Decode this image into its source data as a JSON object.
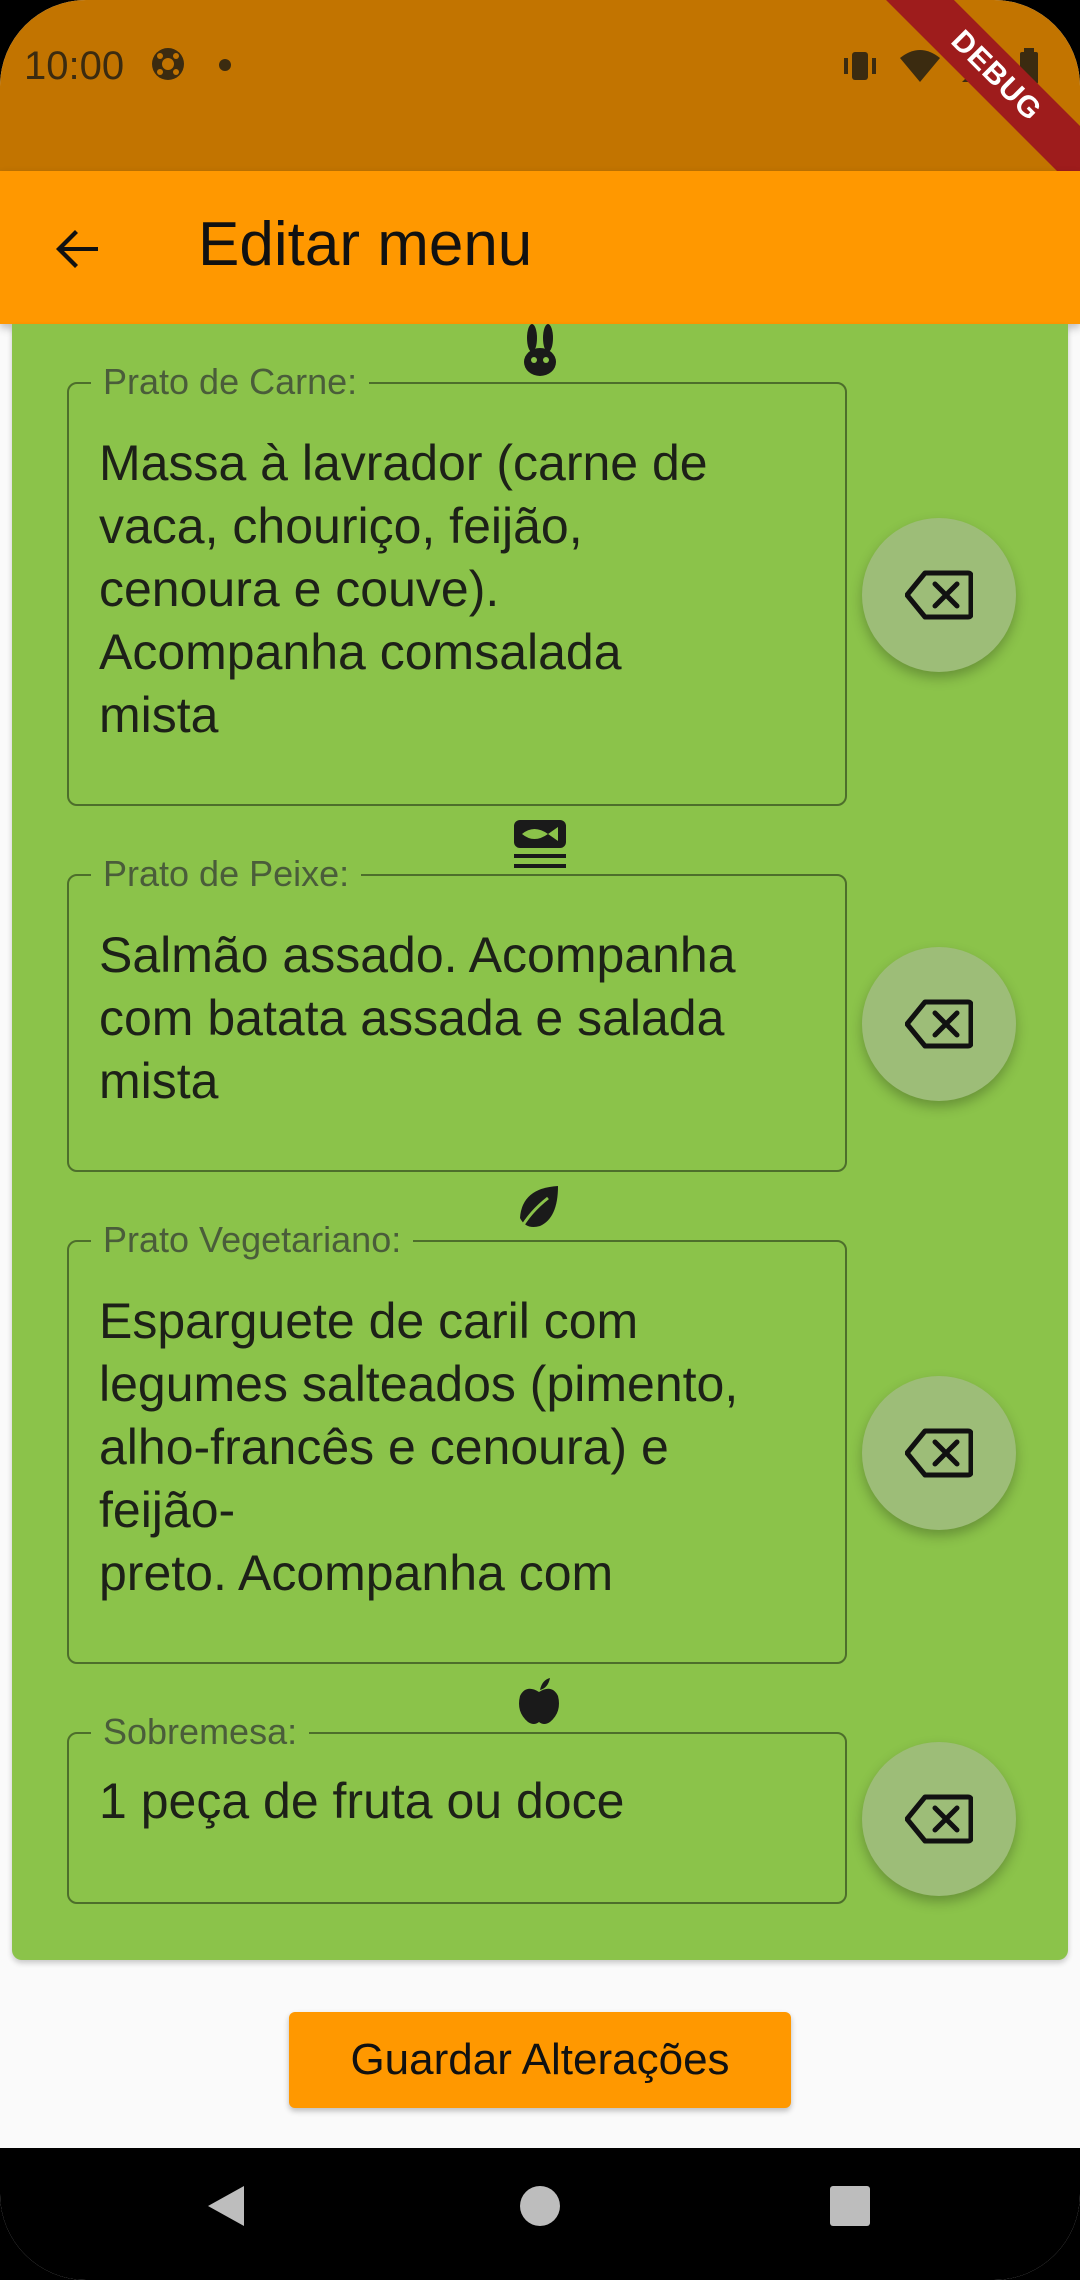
{
  "status_bar": {
    "time": "10:00",
    "icons": [
      "soccer-ball-icon",
      "notification-dot-icon",
      "vibrate-icon",
      "wifi-icon",
      "signal-icon",
      "battery-icon"
    ],
    "debug_banner": "DEBUG",
    "background_color": "#c27400"
  },
  "app_bar": {
    "title": "Editar menu",
    "back_icon": "arrow-back-icon",
    "background_color": "#ff9800"
  },
  "menu": {
    "background_color": "#8bc34a",
    "fields": [
      {
        "icon": "rabbit-icon",
        "label": "Prato de Carne:",
        "value": "Massa à lavrador (carne de\nvaca, chouriço, feijão,\ncenoura e couve).\nAcompanha comsalada\nmista",
        "delete_icon": "backspace-icon"
      },
      {
        "icon": "fish-plate-icon",
        "label": "Prato de Peixe:",
        "value": "Salmão assado. Acompanha\ncom batata assada e salada\nmista",
        "delete_icon": "backspace-icon"
      },
      {
        "icon": "leaf-icon",
        "label": "Prato Vegetariano:",
        "value": "Esparguete de caril com\nlegumes salteados (pimento,\nalho-francês e cenoura) e\nfeijão-\npreto. Acompanha com",
        "delete_icon": "backspace-icon"
      },
      {
        "icon": "apple-icon",
        "label": "Sobremesa:",
        "value": "1 peça de fruta ou doce",
        "delete_icon": "backspace-icon"
      }
    ]
  },
  "save_button": {
    "label": "Guardar Alterações"
  },
  "nav_bar": {
    "icons": [
      "nav-back-icon",
      "nav-home-icon",
      "nav-recents-icon"
    ]
  }
}
